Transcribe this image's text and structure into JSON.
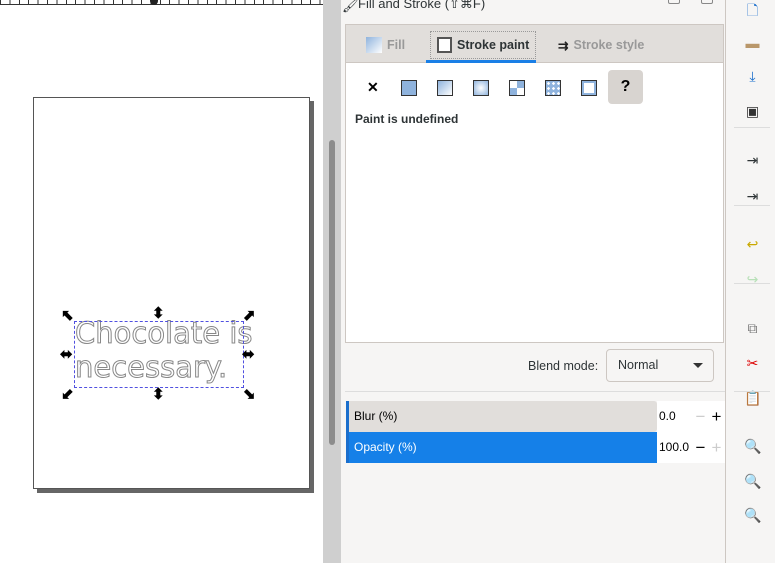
{
  "canvas": {
    "text_lines": [
      "Chocolate is",
      "necessary."
    ]
  },
  "dialog": {
    "title": "Fill and Stroke (⇧⌘F)",
    "tabs": [
      {
        "label": "Fill",
        "active": false
      },
      {
        "label": "Stroke paint",
        "active": true
      },
      {
        "label": "Stroke style",
        "active": false
      }
    ],
    "paint_buttons": [
      "no-paint",
      "flat-color",
      "linear-gradient",
      "radial-gradient",
      "pattern",
      "swatch",
      "unset"
    ],
    "unset_label": "?",
    "status": "Paint is undefined",
    "blend_label": "Blend mode:",
    "blend_value": "Normal",
    "blur": {
      "label": "Blur (%)",
      "value": "0.0"
    },
    "opacity": {
      "label": "Opacity (%)",
      "value": "100.0"
    },
    "accent": "#1580e8"
  },
  "toolbar": {
    "icons": [
      "new-document",
      "open",
      "import",
      "save",
      "import-file",
      "export-file",
      "undo",
      "redo",
      "duplicate",
      "cut",
      "paste",
      "zoom-selection",
      "zoom-drawing",
      "zoom-page"
    ]
  }
}
